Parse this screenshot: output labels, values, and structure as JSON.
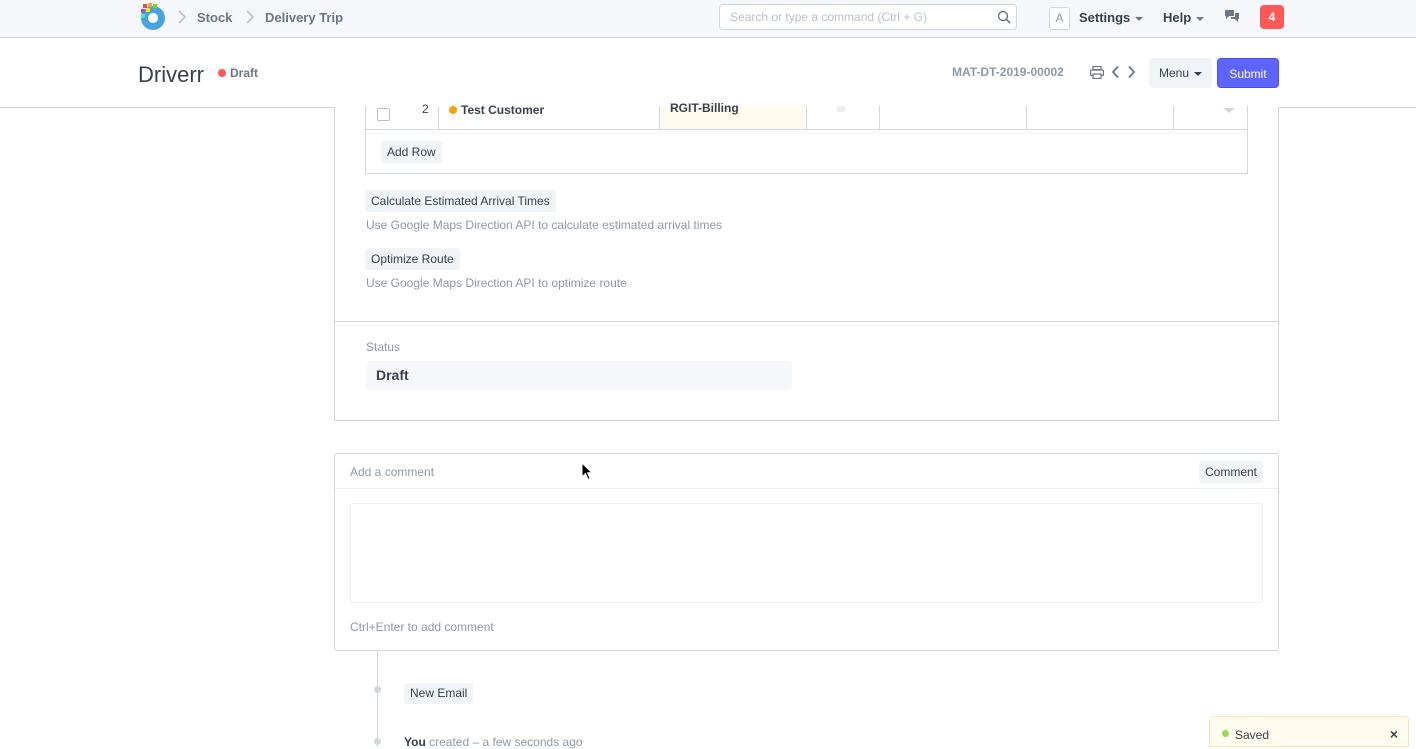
{
  "navbar": {
    "breadcrumbs": [
      "Stock",
      "Delivery Trip"
    ],
    "search_placeholder": "Search or type a command (Ctrl + G)",
    "avatar_letter": "A",
    "settings_label": "Settings",
    "help_label": "Help",
    "notification_count": "4"
  },
  "page": {
    "title": "Driverr",
    "status_indicator": "Draft",
    "status_color": "#ff5858",
    "doc_name": "MAT-DT-2019-00002",
    "menu_label": "Menu",
    "submit_label": "Submit"
  },
  "stops_table": {
    "rows": [
      {
        "idx": "2",
        "customer": "Test Customer",
        "customer_dot_color": "#ffa00a",
        "address": "RGIT-Billing"
      }
    ],
    "add_row_label": "Add Row"
  },
  "actions": {
    "calc_label": "Calculate Estimated Arrival Times",
    "calc_help": "Use Google Maps Direction API to calculate estimated arrival times",
    "optimize_label": "Optimize Route",
    "optimize_help": "Use Google Maps Direction API to optimize route"
  },
  "status_field": {
    "label": "Status",
    "value": "Draft"
  },
  "comment": {
    "title": "Add a comment",
    "button": "Comment",
    "hint": "Ctrl+Enter to add comment"
  },
  "timeline": {
    "new_email_label": "New Email",
    "entry_user": "You",
    "entry_text": " created – a few seconds ago"
  },
  "toast": {
    "text": "Saved",
    "close": "×"
  }
}
